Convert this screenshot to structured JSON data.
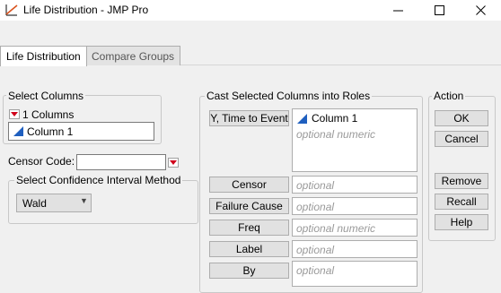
{
  "window": {
    "title": "Life Distribution - JMP Pro",
    "min_glyph": "—",
    "max_glyph": "☐",
    "close_glyph": "✕"
  },
  "tabs": [
    {
      "label": "Life Distribution",
      "selected": true
    },
    {
      "label": "Compare Groups",
      "selected": false
    }
  ],
  "select_columns": {
    "title": "Select Columns",
    "count_label": "1 Columns",
    "columns": [
      {
        "name": "Column 1",
        "icon": "continuous-column-icon"
      }
    ]
  },
  "censor": {
    "label": "Censor Code:",
    "value": ""
  },
  "confidence": {
    "title": "Select Confidence Interval Method",
    "selected": "Wald"
  },
  "cast": {
    "title": "Cast Selected Columns into Roles",
    "roles": [
      {
        "label": "Y, Time to Event",
        "column": "Column 1",
        "placeholder": "optional numeric"
      },
      {
        "label": "Censor",
        "placeholder": "optional"
      },
      {
        "label": "Failure Cause",
        "placeholder": "optional"
      },
      {
        "label": "Freq",
        "placeholder": "optional numeric"
      },
      {
        "label": "Label",
        "placeholder": "optional"
      },
      {
        "label": "By",
        "placeholder": "optional"
      }
    ]
  },
  "action": {
    "title": "Action",
    "buttons": [
      "OK",
      "Cancel",
      "Remove",
      "Recall",
      "Help"
    ]
  },
  "colors": {
    "red_triangle": "#d0021b",
    "column_icon_blue": "#1f5fbf"
  }
}
